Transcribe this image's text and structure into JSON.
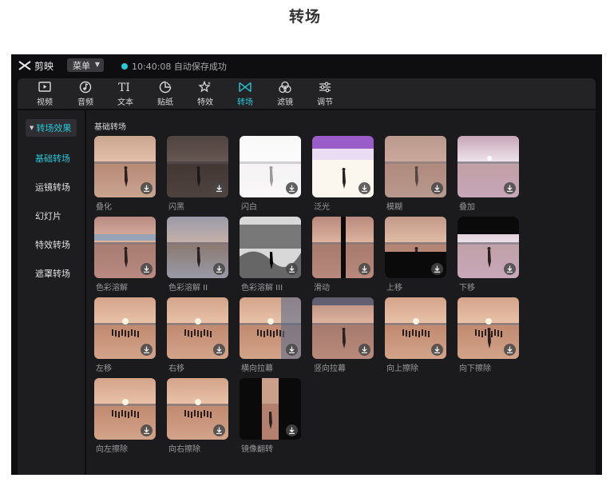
{
  "page": {
    "heading": "转场"
  },
  "app": {
    "name": "剪映",
    "menu_label": "菜单",
    "save_status": "10:40:08 自动保存成功"
  },
  "toolbar": {
    "items": [
      {
        "label": "视频",
        "icon": "video-icon"
      },
      {
        "label": "音频",
        "icon": "audio-icon"
      },
      {
        "label": "文本",
        "icon": "text-icon"
      },
      {
        "label": "贴纸",
        "icon": "sticker-icon"
      },
      {
        "label": "特效",
        "icon": "effects-icon"
      },
      {
        "label": "转场",
        "icon": "transition-icon"
      },
      {
        "label": "滤镜",
        "icon": "filter-icon"
      },
      {
        "label": "调节",
        "icon": "adjust-icon"
      }
    ],
    "active": "转场",
    "accent_color": "#24c8d6"
  },
  "sidebar": {
    "header": "转场效果",
    "items": [
      {
        "label": "基础转场",
        "active": true
      },
      {
        "label": "运镜转场",
        "active": false
      },
      {
        "label": "幻灯片",
        "active": false
      },
      {
        "label": "特效转场",
        "active": false
      },
      {
        "label": "遮罩转场",
        "active": false
      }
    ]
  },
  "content": {
    "section_title": "基础转场",
    "cards": [
      {
        "label": "叠化",
        "style": "sunset"
      },
      {
        "label": "闪黑",
        "style": "dark"
      },
      {
        "label": "闪白",
        "style": "white"
      },
      {
        "label": "泛光",
        "style": "glow"
      },
      {
        "label": "模糊",
        "style": "blur"
      },
      {
        "label": "叠加",
        "style": "overlay"
      },
      {
        "label": "色彩溶解",
        "style": "dissolve"
      },
      {
        "label": "色彩溶解 II",
        "style": "dissolve2"
      },
      {
        "label": "色彩溶解 III",
        "style": "bw"
      },
      {
        "label": "滑动",
        "style": "slide"
      },
      {
        "label": "上移",
        "style": "up"
      },
      {
        "label": "下移",
        "style": "down"
      },
      {
        "label": "左移",
        "style": "pier"
      },
      {
        "label": "右移",
        "style": "pier"
      },
      {
        "label": "横向拉幕",
        "style": "hcurtain"
      },
      {
        "label": "竖向拉幕",
        "style": "vcurtain"
      },
      {
        "label": "向上擦除",
        "style": "pier"
      },
      {
        "label": "向下擦除",
        "style": "wipedown"
      },
      {
        "label": "向左擦除",
        "style": "pier"
      },
      {
        "label": "向右擦除",
        "style": "pier"
      },
      {
        "label": "镜像翻转",
        "style": "mirror"
      }
    ]
  }
}
